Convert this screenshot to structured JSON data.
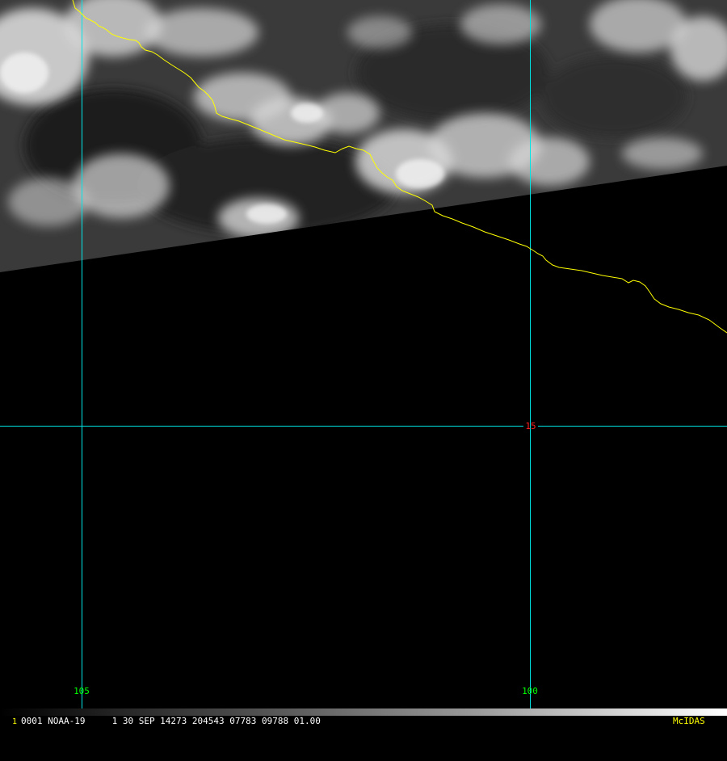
{
  "map": {
    "longitude_labels": [
      "105",
      "100"
    ],
    "latitude_labels": [
      "15"
    ],
    "colors": {
      "grid": "#00e5e5",
      "coastline": "#ffff00",
      "longitude_label": "#00ff00",
      "latitude_label": "#ff2020",
      "background": "#000000"
    }
  },
  "status_bar": {
    "frame": "1",
    "text": "0001 NOAA-19     1 30 SEP 14273 204543 07783 09788 01.00",
    "brand": "McIDAS"
  }
}
